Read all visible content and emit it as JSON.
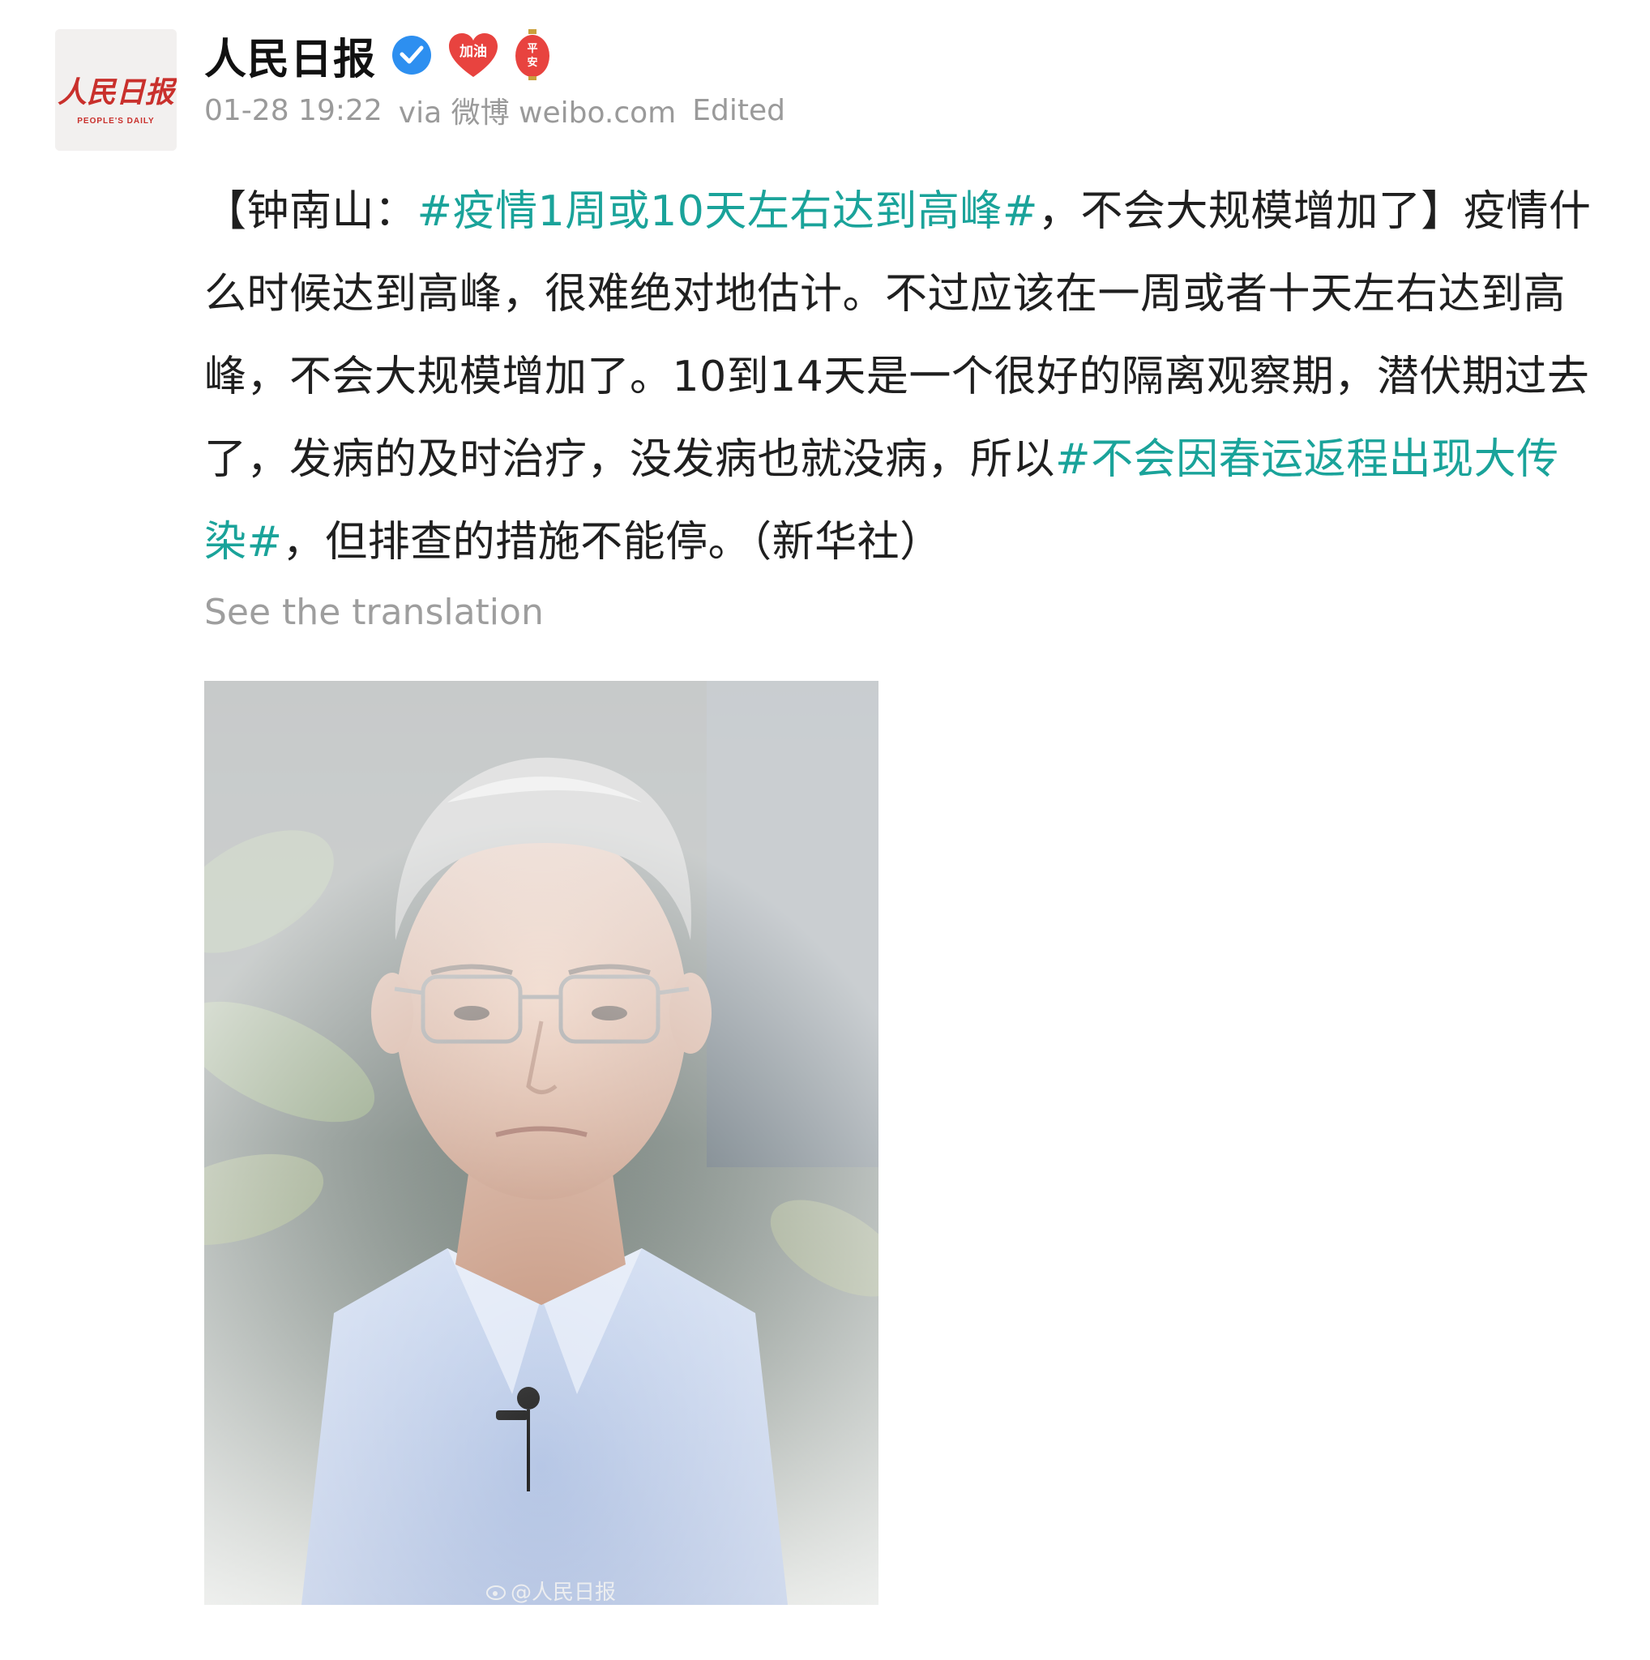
{
  "account": {
    "name": "人民日报",
    "avatar_logo_text": "人民日报",
    "avatar_logo_subtext": "PEOPLE'S DAILY",
    "verified_icon": "verified-check-icon",
    "badges": [
      {
        "name": "jiayou-heart-badge",
        "text": "加油",
        "color": "#e8433f"
      },
      {
        "name": "pingan-lantern-badge",
        "text": "平安",
        "color": "#e8433f"
      }
    ]
  },
  "meta": {
    "timestamp": "01-28 19:22",
    "via_text": "via 微博 weibo.com",
    "edited": "Edited"
  },
  "post": {
    "segments": [
      {
        "type": "text",
        "text": "【钟南山："
      },
      {
        "type": "hashtag",
        "text": "#疫情1周或10天左右达到高峰#"
      },
      {
        "type": "text",
        "text": "，不会大规模增加了】疫情什么时候达到高峰，很难绝对地估计。不过应该在一周或者十天左右达到高峰，不会大规模增加了。10到14天是一个很好的隔离观察期，潜伏期过去了，发病的及时治疗，没发病也就没病，所以"
      },
      {
        "type": "hashtag",
        "text": "#不会因春运返程出现大传染#"
      },
      {
        "type": "text",
        "text": "，但排查的措施不能停。（新华社）"
      }
    ],
    "translate_label": "See the translation"
  },
  "image": {
    "watermark": "@人民日报"
  },
  "colors": {
    "hashtag": "#1aa39a",
    "meta": "#9a9a9a",
    "verified": "#2d8ff0"
  }
}
